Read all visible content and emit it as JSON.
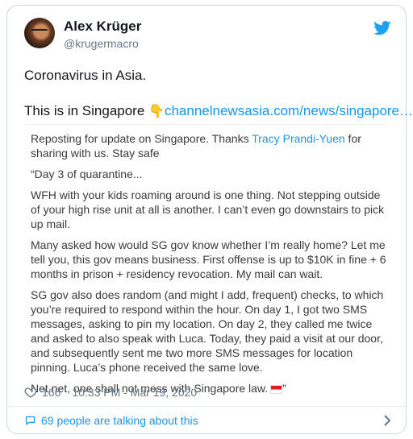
{
  "user": {
    "display_name": "Alex Krüger",
    "handle": "@krugermacro"
  },
  "tweet": {
    "line1": "Coronavirus in Asia.",
    "line2_prefix": "This is in Singapore ",
    "link_text": "channelnewsasia.com/news/singapore…"
  },
  "quote": {
    "p1_prefix": "Reposting for update on Singapore. Thanks ",
    "p1_mention": "Tracy Prandi-Yuen",
    "p1_suffix": " for sharing with us. Stay safe",
    "p2": "“Day 3 of quarantine...",
    "p3": "WFH with your kids roaming around is one thing. Not stepping outside of your high rise unit at all is another. I can’t even go downstairs to pick up mail.",
    "p4": "Many asked how would SG gov know whether I’m really home? Let me tell you, this gov means business. First offense is up to $10K in fine + 6 months in prison + residency revocation. My mail can wait.",
    "p5": "SG gov also does random (and might I add, frequent) checks, to which you’re required to respond within the hour. On day 1, I got two SMS messages, asking to pin my location. On day 2, they called me twice and asked to also speak with Luca. Today, they paid a visit at our door, and subsequently sent me two more SMS messages for location pinning. Luca’s phone received the same love.",
    "p6": "Net net, one shall not mess with Singapore law.",
    "p6_end": "”"
  },
  "meta": {
    "likes": "166",
    "timestamp": "10:33 PM - Mar 19, 2020"
  },
  "footer": {
    "talking": "69 people are talking about this"
  },
  "icons": {
    "bird": "twitter-bird-icon",
    "pointing": "backhand-index-pointing-down-icon",
    "flag": "singapore-flag-icon",
    "heart": "heart-icon",
    "bubble": "speech-bubble-icon",
    "chevron": "chevron-right-icon"
  },
  "colors": {
    "accent": "#1b95e0",
    "muted": "#657786",
    "text": "#14171a"
  }
}
